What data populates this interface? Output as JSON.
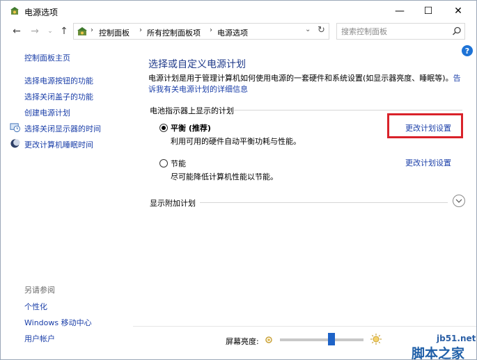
{
  "window": {
    "title": "电源选项",
    "minimize_glyph": "—",
    "maximize_glyph": "☐",
    "close_glyph": "✕"
  },
  "nav": {
    "back_glyph": "←",
    "forward_glyph": "→",
    "recent_glyph": "⌄",
    "up_glyph": "↑",
    "breadcrumbs": [
      "控制面板",
      "所有控制面板项",
      "电源选项"
    ],
    "separator": "›",
    "dropdown_glyph": "⌄",
    "refresh_glyph": "↻"
  },
  "search": {
    "placeholder": "搜索控制面板"
  },
  "sidebar": {
    "items": [
      {
        "label": "控制面板主页",
        "icon": null
      },
      {
        "label": "选择电源按钮的功能",
        "icon": null
      },
      {
        "label": "选择关闭盖子的功能",
        "icon": null
      },
      {
        "label": "创建电源计划",
        "icon": null
      },
      {
        "label": "选择关闭显示器的时间",
        "icon": "monitor-clock-icon"
      },
      {
        "label": "更改计算机睡眠时间",
        "icon": "moon-icon"
      }
    ],
    "see_also_heading": "另请参阅",
    "see_also": [
      {
        "label": "个性化"
      },
      {
        "label": "Windows 移动中心"
      },
      {
        "label": "用户帐户"
      }
    ]
  },
  "main": {
    "help_glyph": "?",
    "title": "选择或自定义电源计划",
    "desc_text": "电源计划是用于管理计算机如何使用电源的一套硬件和系统设置(如显示器亮度、睡眠等)。",
    "desc_link_part1": "告",
    "desc_link_part2": "诉我有关电源计划的详细信息",
    "battery_group_label": "电池指示器上显示的计划",
    "plans": [
      {
        "name": "平衡 (推荐)",
        "desc": "利用可用的硬件自动平衡功耗与性能。",
        "selected": true,
        "change_link": "更改计划设置"
      },
      {
        "name": "节能",
        "desc": "尽可能降低计算机性能以节能。",
        "selected": false,
        "change_link": "更改计划设置"
      }
    ],
    "additional_plans_label": "显示附加计划"
  },
  "brightness": {
    "label": "屏幕亮度:",
    "level": 0.62
  },
  "watermark": {
    "url": "jb51.net",
    "text": "脚本之家"
  },
  "colors": {
    "link": "#1a3ea8",
    "title": "#1f3a8a",
    "highlight_box": "#d9222a",
    "slider_thumb": "#1e63c7"
  }
}
